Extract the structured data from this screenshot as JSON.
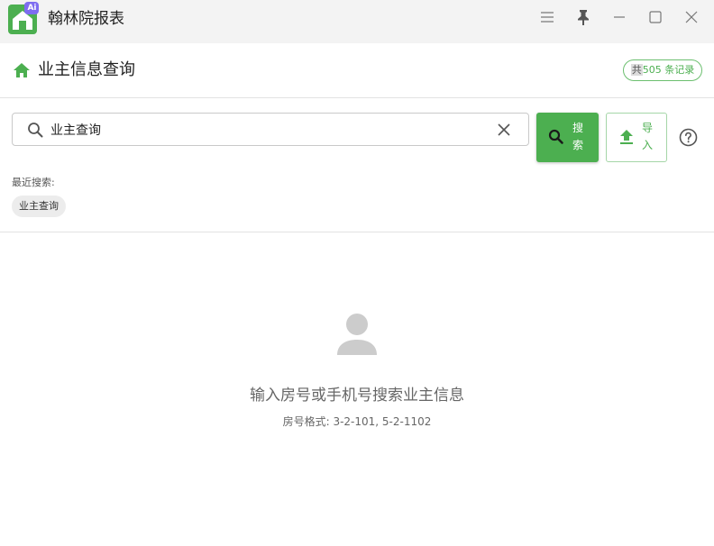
{
  "app": {
    "title": "翰林院报表",
    "logo_badge": "Ai",
    "brand_color": "#4caf50"
  },
  "window_controls": {
    "icons": [
      "menu-icon",
      "pin-icon",
      "minimize-icon",
      "maximize-icon",
      "close-icon"
    ]
  },
  "header": {
    "title": "业主信息查询",
    "record_prefix": "共",
    "record_rest": "505 条记录"
  },
  "search": {
    "value": "业主查询",
    "placeholder": "",
    "search_button": "搜索",
    "import_button": "导入"
  },
  "recent": {
    "label": "最近搜索:",
    "items": [
      "业主查询"
    ]
  },
  "empty_state": {
    "icon": "person-icon",
    "message": "输入房号或手机号搜索业主信息",
    "hint": "房号格式: 3-2-101, 5-2-1102"
  }
}
